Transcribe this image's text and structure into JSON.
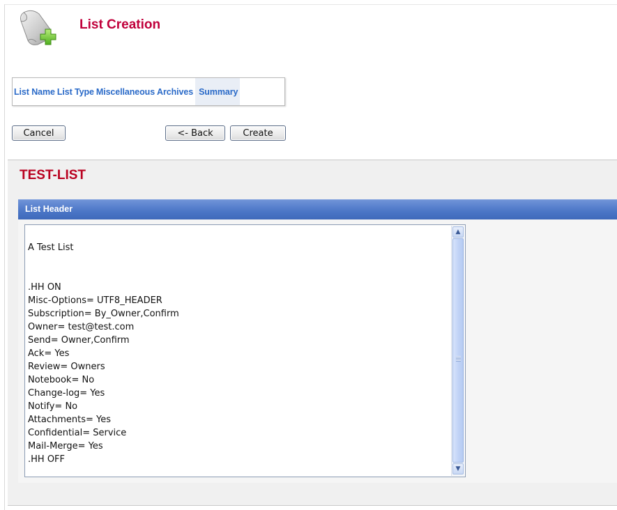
{
  "header": {
    "title": "List Creation",
    "icon": "scroll-add-icon"
  },
  "wizard": {
    "steps": [
      {
        "label": "List Name"
      },
      {
        "label": "List Type"
      },
      {
        "label": "Miscellaneous"
      },
      {
        "label": "Archives"
      },
      {
        "label": "Summary",
        "active": true
      }
    ]
  },
  "buttons": {
    "cancel": "Cancel",
    "back": "<- Back",
    "create": "Create"
  },
  "list": {
    "name": "TEST-LIST",
    "section_title": "List Header",
    "header_text": "\nA Test List\n\n\n.HH ON\nMisc-Options= UTF8_HEADER\nSubscription= By_Owner,Confirm\nOwner= test@test.com\nSend= Owner,Confirm\nAck= Yes\nReview= Owners\nNotebook= No\nChange-log= Yes\nNotify= No\nAttachments= Yes\nConfidential= Service\nMail-Merge= Yes\n.HH OFF"
  },
  "colors": {
    "title_red": "#c0003b",
    "list_name_red": "#b9001f",
    "step_blue": "#2a6ac8",
    "section_blue": "#4a75c6"
  }
}
